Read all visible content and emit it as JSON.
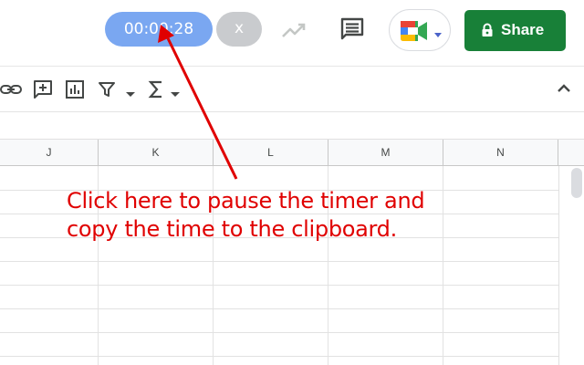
{
  "timer": {
    "time": "00:00:28",
    "close_label": "x"
  },
  "topbar": {
    "share_label": "Share"
  },
  "icons": {
    "link": "link-icon",
    "comment_add": "add-comment-icon",
    "chart": "insert-chart-icon",
    "filter": "filter-icon",
    "functions": "functions-sigma-icon",
    "collapse": "chevron-up-icon",
    "trend": "trending-up-icon",
    "comments": "comment-icon",
    "meet": "google-meet-icon",
    "lock": "lock-icon"
  },
  "grid": {
    "columns": [
      "J",
      "K",
      "L",
      "M",
      "N"
    ]
  },
  "annotation": {
    "line1": "Click here to pause the timer and",
    "line2": "copy the time to the clipboard."
  },
  "colors": {
    "timer_bg": "#7aa7f1",
    "close_bg": "#c9cbce",
    "share_bg": "#188038",
    "annotation": "#e00000"
  }
}
